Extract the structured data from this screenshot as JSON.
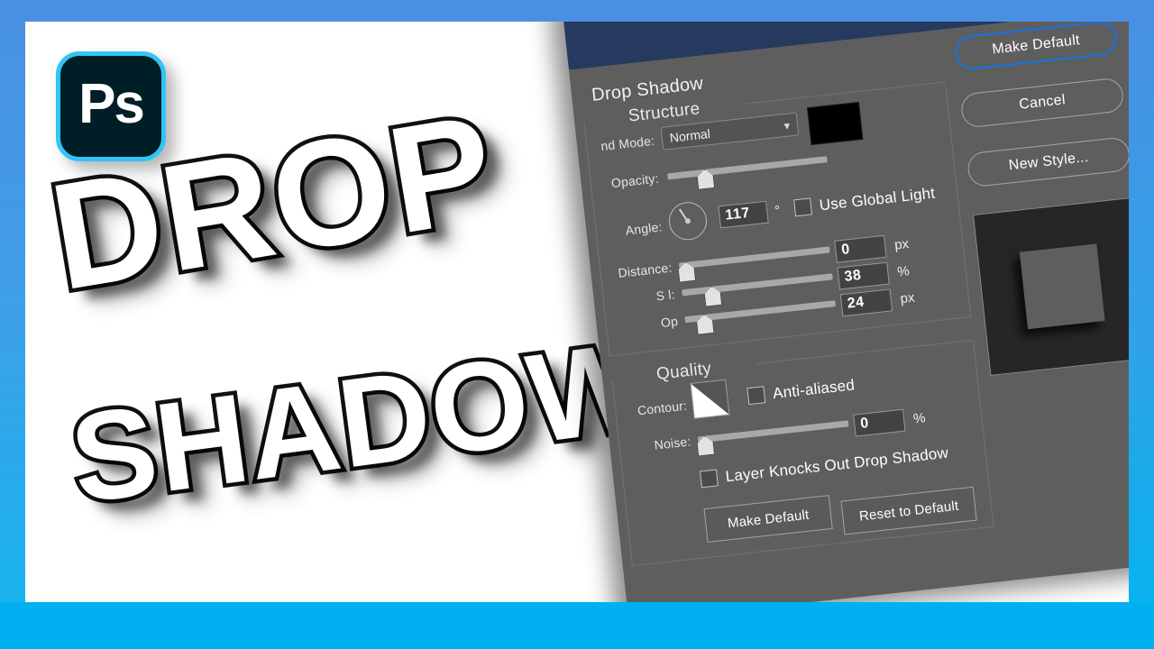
{
  "canvas": {
    "background_color": "#ffffff",
    "frame_color_top": "#4a90e2",
    "frame_color_bottom": "#00b0f0"
  },
  "logo": {
    "name": "photoshop-logo",
    "text": "Ps",
    "background_color": "#001e26",
    "border_color": "#31c5f4"
  },
  "headline": {
    "line1": "DROP",
    "line2": "SHADOW!"
  },
  "dialog": {
    "titlebar_color": "#253a5e",
    "body_color": "#5e5e5e",
    "close_label": "✕",
    "title": "Drop Shadow",
    "sections": {
      "structure": "Structure",
      "quality": "Quality"
    },
    "structure": {
      "blend_mode_label": "nd Mode:",
      "blend_mode_value": "Normal",
      "blend_mode_chevron": "❯",
      "color_swatch": "#000000",
      "opacity_label": "Opacity:",
      "opacity_value": "",
      "angle_label": "Angle:",
      "angle_value": "117",
      "angle_unit": "°",
      "use_global_light_label": "Use Global Light",
      "distance_label": "Distance:",
      "distance_value": "0",
      "distance_unit": "px",
      "spread_label": "S        l:",
      "spread_value": "38",
      "spread_unit": "%",
      "size_label": "Op",
      "size_value": "24",
      "size_unit": "px"
    },
    "quality": {
      "contour_label": "Contour:",
      "anti_aliased_label": "Anti-aliased",
      "noise_label": "Noise:",
      "noise_value": "0",
      "noise_unit": "%",
      "knockout_label": "Layer Knocks Out Drop Shadow"
    },
    "side_buttons": [
      {
        "label": "Make Default",
        "primary": true
      },
      {
        "label": "Cancel",
        "primary": false
      },
      {
        "label": "New Style...",
        "primary": false
      }
    ],
    "bottom_buttons": [
      {
        "label": "Make Default"
      },
      {
        "label": "Reset to Default"
      }
    ],
    "preview": {
      "name": "preview-thumbnail",
      "background_color": "#262626",
      "shape_color": "#5e5e5e"
    }
  }
}
